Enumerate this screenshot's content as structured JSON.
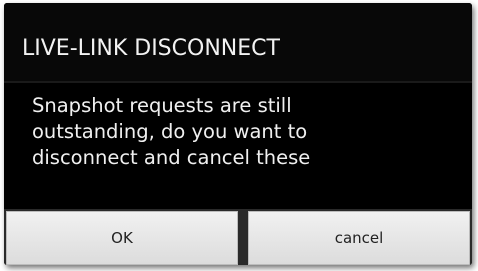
{
  "dialog": {
    "title": "LIVE-LINK DISCONNECT",
    "message_line_1": "Snapshot requests are still",
    "message_line_2": "outstanding, do you want to",
    "message_line_3": "disconnect and cancel these",
    "ok_label": "OK",
    "cancel_label": "cancel"
  },
  "colors": {
    "dialog_background": "#000000",
    "text": "#f0f0f0",
    "button_background": "#e6e6e6",
    "button_text": "#222222"
  }
}
